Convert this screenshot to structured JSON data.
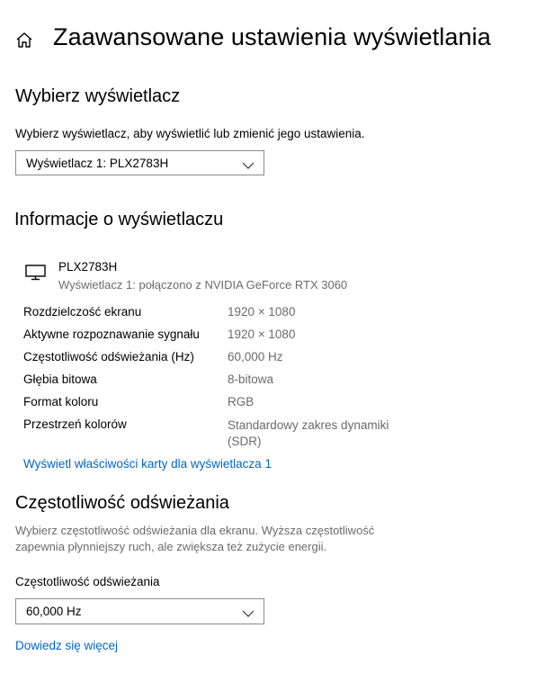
{
  "header": {
    "title": "Zaawansowane ustawienia wyświetlania",
    "home_icon": "home-icon"
  },
  "select_display": {
    "heading": "Wybierz wyświetlacz",
    "description": "Wybierz wyświetlacz, aby wyświetlić lub zmienić jego ustawienia.",
    "dropdown_value": "Wyświetlacz 1: PLX2783H"
  },
  "display_info": {
    "heading": "Informacje o wyświetlaczu",
    "monitor_icon": "monitor-icon",
    "monitor_name": "PLX2783H",
    "monitor_subtitle": "Wyświetlacz 1: połączono z NVIDIA GeForce RTX 3060",
    "rows": [
      {
        "label": "Rozdzielczość ekranu",
        "value": "1920 × 1080"
      },
      {
        "label": "Aktywne rozpoznawanie sygnału",
        "value": "1920 × 1080"
      },
      {
        "label": "Częstotliwość odświeżania (Hz)",
        "value": "60,000 Hz"
      },
      {
        "label": "Głębia bitowa",
        "value": "8-bitowa"
      },
      {
        "label": "Format koloru",
        "value": "RGB"
      },
      {
        "label": "Przestrzeń kolorów",
        "value": "Standardowy zakres dynamiki (SDR)"
      }
    ],
    "adapter_link": "Wyświetl właściwości karty dla wyświetlacza 1"
  },
  "refresh_rate": {
    "heading": "Częstotliwość odświeżania",
    "description": "Wybierz częstotliwość odświeżania dla ekranu. Wyższa częstotliwość zapewnia płynniejszy ruch, ale zwiększa też zużycie energii.",
    "dropdown_label": "Częstotliwość odświeżania",
    "dropdown_value": "60,000 Hz",
    "learn_more_link": "Dowiedz się więcej"
  },
  "colors": {
    "link": "#0067c0",
    "muted_text": "#6b6b6b",
    "border": "#8a8a8a"
  }
}
